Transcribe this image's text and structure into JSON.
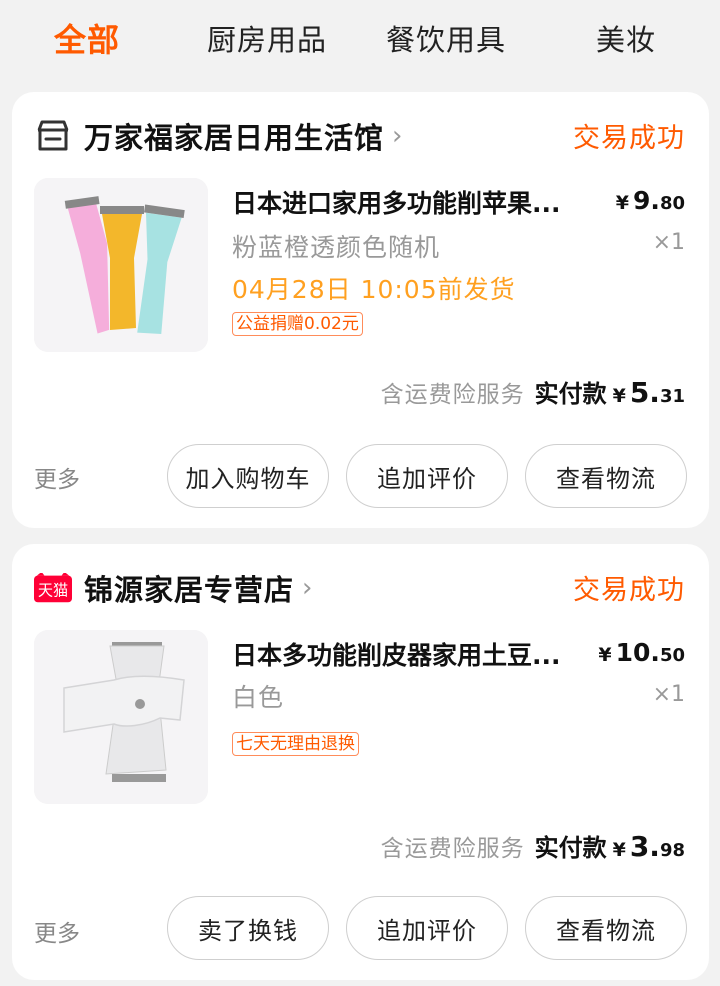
{
  "tabs": [
    {
      "label": "全部",
      "active": true
    },
    {
      "label": "厨房用品",
      "active": false
    },
    {
      "label": "餐饮用具",
      "active": false
    },
    {
      "label": "美妆",
      "active": false
    }
  ],
  "orders": [
    {
      "shop_name": "万家福家居日用生活馆",
      "shop_icon": "store-icon",
      "status": "交易成功",
      "title": "日本进口家用多功能削苹果...",
      "price_symbol": "¥",
      "price_int": "9.",
      "price_dec": "80",
      "sku": "粉蓝橙透颜色随机",
      "qty": "×1",
      "ship_note": "04月28日 10:05前发货",
      "tag": "公益捐赠0.02元",
      "insurance": "含运费险服务",
      "paid_label": "实付款",
      "paid_symbol": "¥",
      "paid_int": "5.",
      "paid_dec": "31",
      "more": "更多",
      "buttons": [
        "加入购物车",
        "追加评价",
        "查看物流"
      ]
    },
    {
      "shop_name": "锦源家居专营店",
      "shop_icon": "tmall-icon",
      "shop_icon_text": "天猫",
      "status": "交易成功",
      "title": "日本多功能削皮器家用土豆...",
      "price_symbol": "¥",
      "price_int": "10.",
      "price_dec": "50",
      "sku": "白色",
      "qty": "×1",
      "tag": "七天无理由退换",
      "insurance": "含运费险服务",
      "paid_label": "实付款",
      "paid_symbol": "¥",
      "paid_int": "3.",
      "paid_dec": "98",
      "more": "更多",
      "buttons": [
        "卖了换钱",
        "追加评价",
        "查看物流"
      ]
    }
  ],
  "colors": {
    "accent": "#ff5a00",
    "ship": "#ffa020",
    "tmall_red": "#ff0036"
  }
}
